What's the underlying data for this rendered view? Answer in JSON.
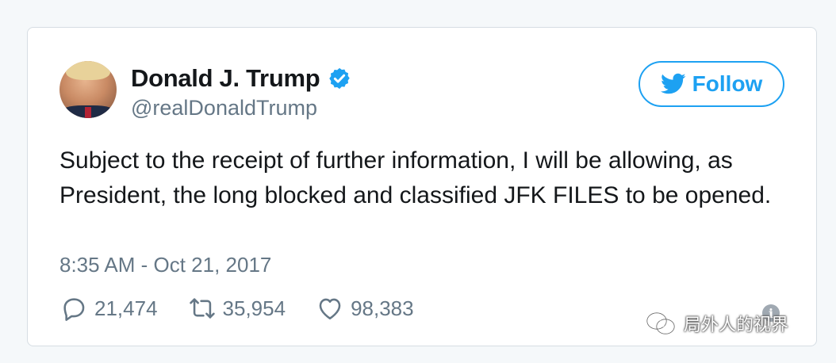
{
  "user": {
    "name": "Donald J. Trump",
    "handle": "@realDonaldTrump"
  },
  "follow_button": {
    "label": "Follow"
  },
  "tweet": {
    "text": "Subject to the receipt of further information, I will be allowing, as President, the long blocked and classified JFK FILES to be opened.",
    "timestamp": "8:35 AM - Oct 21, 2017"
  },
  "actions": {
    "replies": "21,474",
    "retweets": "35,954",
    "likes": "98,383"
  },
  "watermark": {
    "text": "局外人的视界"
  },
  "colors": {
    "brand_blue": "#1da1f2",
    "secondary_text": "#657786",
    "primary_text": "#14171a"
  },
  "icons": [
    "verified-badge-icon",
    "twitter-bird-icon",
    "reply-icon",
    "retweet-icon",
    "like-icon",
    "info-icon",
    "wechat-icon"
  ]
}
